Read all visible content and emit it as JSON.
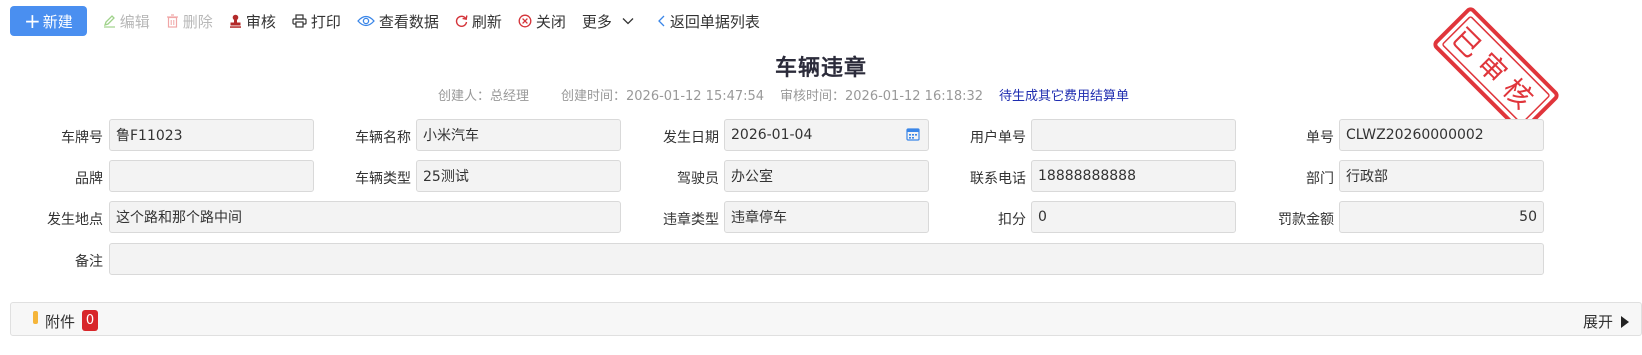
{
  "toolbar": {
    "new": "新建",
    "edit": "编辑",
    "delete": "删除",
    "audit": "审核",
    "print": "打印",
    "view_data": "查看数据",
    "refresh": "刷新",
    "close": "关闭",
    "more": "更多",
    "back": "返回单据列表"
  },
  "page": {
    "title": "车辆违章",
    "creator": "创建人：总经理",
    "created_time": "创建时间：2026-01-12 15:47:54",
    "audit_time": "审核时间：2026-01-12 16:18:32",
    "pending_status": "待生成其它费用结算单"
  },
  "stamp": {
    "text": "已审核",
    "color": "#e0353b"
  },
  "form": {
    "plate": {
      "label": "车牌号",
      "value": "鲁F11023"
    },
    "vehicle_name": {
      "label": "车辆名称",
      "value": "小米汽车"
    },
    "date": {
      "label": "发生日期",
      "value": "2026-01-04"
    },
    "user_no": {
      "label": "用户单号",
      "value": ""
    },
    "doc_no": {
      "label": "单号",
      "value": "CLWZ20260000002"
    },
    "brand": {
      "label": "品牌",
      "value": ""
    },
    "vehicle_type": {
      "label": "车辆类型",
      "value": "25测试"
    },
    "driver": {
      "label": "驾驶员",
      "value": "办公室"
    },
    "phone": {
      "label": "联系电话",
      "value": "18888888888"
    },
    "department": {
      "label": "部门",
      "value": "行政部"
    },
    "location": {
      "label": "发生地点",
      "value": "这个路和那个路中间"
    },
    "violation_type": {
      "label": "违章类型",
      "value": "违章停车"
    },
    "points": {
      "label": "扣分",
      "value": "0"
    },
    "fine": {
      "label": "罚款金额",
      "value": "50"
    },
    "remark": {
      "label": "备注",
      "value": ""
    }
  },
  "attachments": {
    "label": "附件",
    "count": "0",
    "expand": "展开"
  },
  "colors": {
    "primary": "#4a8ff0",
    "pending": "#1f2db0",
    "badge": "#d8262a",
    "marker": "#f5b53a"
  }
}
